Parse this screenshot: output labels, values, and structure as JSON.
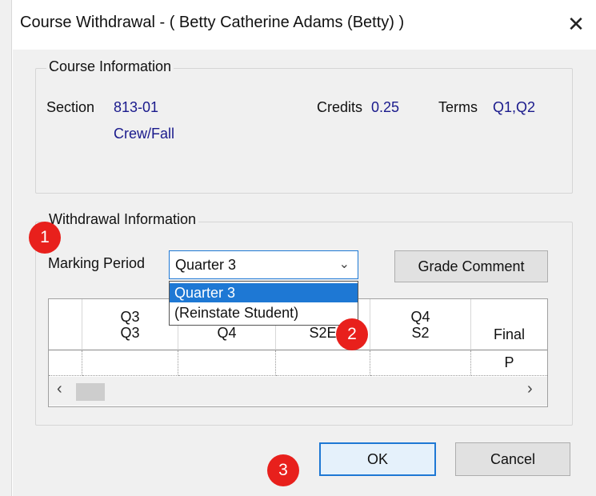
{
  "dialog": {
    "title": "Course Withdrawal - ( Betty Catherine Adams (Betty) )",
    "close_glyph": "✕"
  },
  "course_info": {
    "group_label": "Course Information",
    "section_label": "Section",
    "section_value": "813-01",
    "course_name": "Crew/Fall",
    "credits_label": "Credits",
    "credits_value": "0.25",
    "terms_label": "Terms",
    "terms_value": "Q1,Q2"
  },
  "withdrawal_info": {
    "group_label": "Withdrawal Information",
    "marking_period_label": "Marking Period",
    "marking_period_value": "Quarter 3",
    "options": [
      "Quarter 3",
      "(Reinstate Student)"
    ],
    "grade_comment_label": "Grade Comment"
  },
  "grid": {
    "columns": [
      {
        "line1": "",
        "line2": ""
      },
      {
        "line1": "Q3",
        "line2": "Q3"
      },
      {
        "line1": "",
        "line2": "Q4"
      },
      {
        "line1": "",
        "line2": "S2E"
      },
      {
        "line1": "Q4",
        "line2": "S2"
      },
      {
        "line1": "",
        "line2": "Final"
      }
    ],
    "row": [
      "",
      "",
      "",
      "",
      "",
      "P"
    ]
  },
  "buttons": {
    "ok_label": "OK",
    "cancel_label": "Cancel"
  },
  "badges": [
    "1",
    "2",
    "3"
  ],
  "colors": {
    "accent": "#1e78d4",
    "value_text": "#1a1a8c",
    "badge": "#e8201c"
  }
}
